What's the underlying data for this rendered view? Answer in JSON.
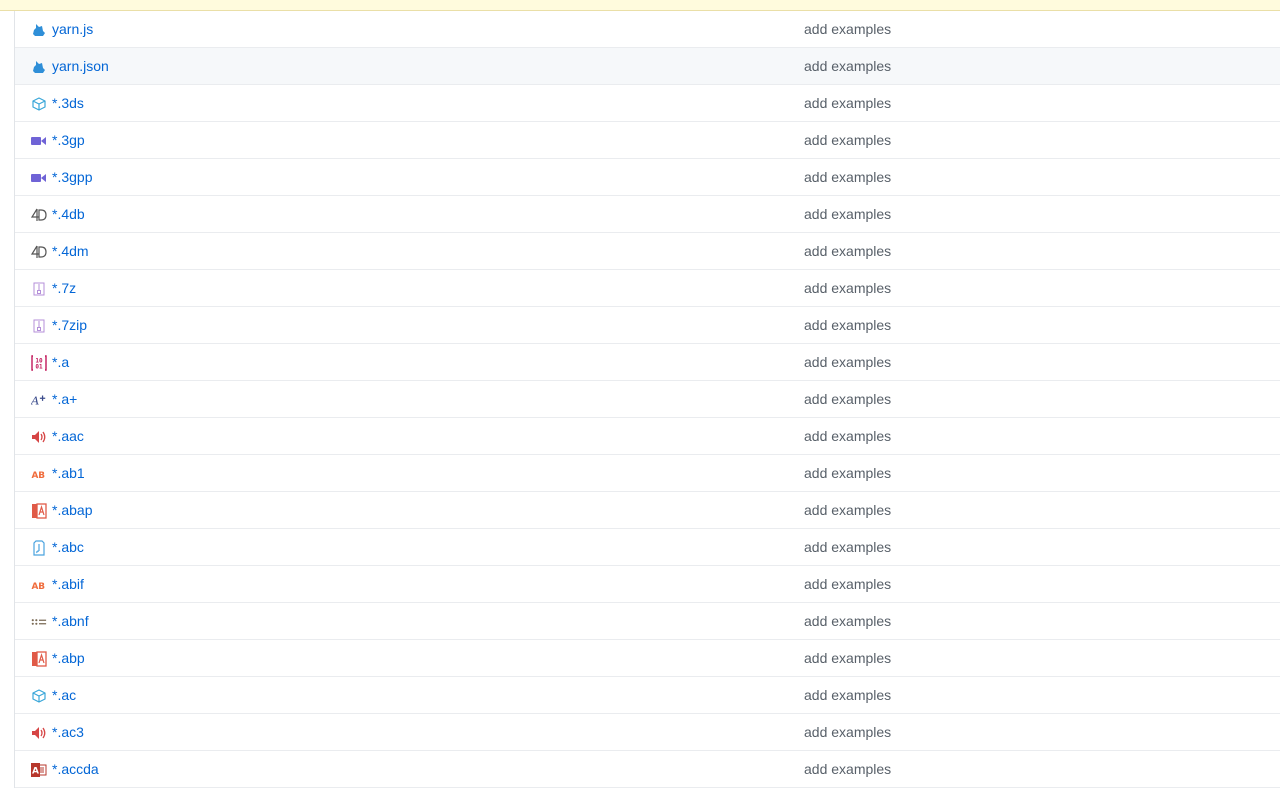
{
  "colors": {
    "link": "#0366d6",
    "message": "#586069",
    "banner": "#fffbdd",
    "row_hover": "#f6f8fa"
  },
  "files": [
    {
      "name": "yarn.js",
      "message": "add examples",
      "icon": "yarn-icon",
      "hover": false
    },
    {
      "name": "yarn.json",
      "message": "add examples",
      "icon": "yarn-icon",
      "hover": true
    },
    {
      "name": "*.3ds",
      "message": "add examples",
      "icon": "cube-icon",
      "hover": false
    },
    {
      "name": "*.3gp",
      "message": "add examples",
      "icon": "video-icon",
      "hover": false
    },
    {
      "name": "*.3gpp",
      "message": "add examples",
      "icon": "video-icon",
      "hover": false
    },
    {
      "name": "*.4db",
      "message": "add examples",
      "icon": "4d-icon",
      "hover": false
    },
    {
      "name": "*.4dm",
      "message": "add examples",
      "icon": "4d-icon",
      "hover": false
    },
    {
      "name": "*.7z",
      "message": "add examples",
      "icon": "archive-icon",
      "hover": false
    },
    {
      "name": "*.7zip",
      "message": "add examples",
      "icon": "archive-icon",
      "hover": false
    },
    {
      "name": "*.a",
      "message": "add examples",
      "icon": "binary-icon",
      "hover": false
    },
    {
      "name": "*.a+",
      "message": "add examples",
      "icon": "a-plus-icon",
      "hover": false
    },
    {
      "name": "*.aac",
      "message": "add examples",
      "icon": "audio-icon",
      "hover": false
    },
    {
      "name": "*.ab1",
      "message": "add examples",
      "icon": "ab-icon",
      "hover": false
    },
    {
      "name": "*.abap",
      "message": "add examples",
      "icon": "abap-icon",
      "hover": false
    },
    {
      "name": "*.abc",
      "message": "add examples",
      "icon": "abc-icon",
      "hover": false
    },
    {
      "name": "*.abif",
      "message": "add examples",
      "icon": "ab-icon",
      "hover": false
    },
    {
      "name": "*.abnf",
      "message": "add examples",
      "icon": "abnf-icon",
      "hover": false
    },
    {
      "name": "*.abp",
      "message": "add examples",
      "icon": "abap-icon",
      "hover": false
    },
    {
      "name": "*.ac",
      "message": "add examples",
      "icon": "cube-icon",
      "hover": false
    },
    {
      "name": "*.ac3",
      "message": "add examples",
      "icon": "audio-icon",
      "hover": false
    },
    {
      "name": "*.accda",
      "message": "add examples",
      "icon": "access-icon",
      "hover": false
    }
  ]
}
